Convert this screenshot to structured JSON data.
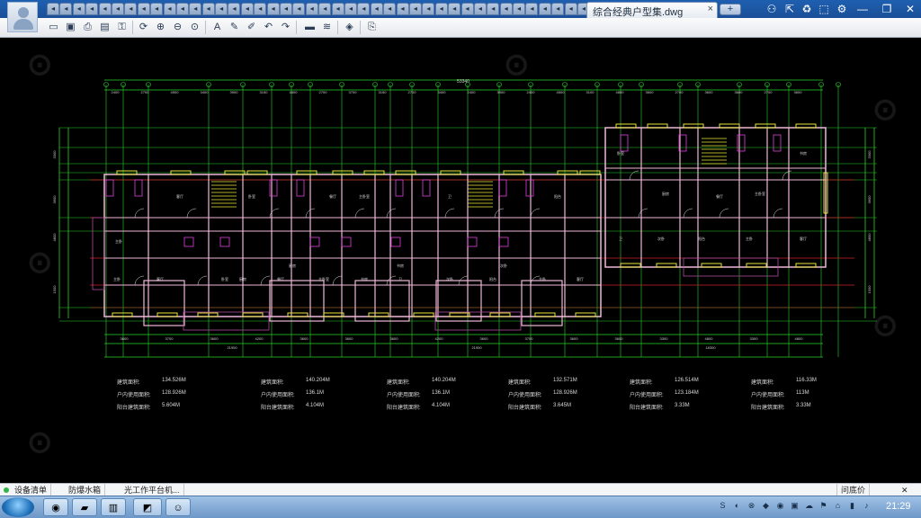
{
  "window": {
    "tab_title": "综合经典户型集.dwg",
    "tab_close": "×",
    "new_tab": "+",
    "controls": [
      "⚇",
      "⇱",
      "♻",
      "⬚",
      "⚙",
      "—",
      "❐",
      "✕"
    ]
  },
  "toolbar": {
    "icons": [
      "open-folder",
      "save",
      "print",
      "pdf",
      "lock",
      "rotate",
      "zoom-in",
      "zoom-out",
      "zoom-window",
      "text",
      "pencil",
      "pen",
      "undo",
      "redo",
      "measure",
      "layers-line",
      "layers",
      "export"
    ]
  },
  "drawing": {
    "top_overall_dim": "53340",
    "top_dims": [
      "2400",
      "2700",
      "4500",
      "3400",
      "3900",
      "3150",
      "4800",
      "2700",
      "3700",
      "3150",
      "2700",
      "3400",
      "2400",
      "3900",
      "2400",
      "4500",
      "3100",
      "4800",
      "3600",
      "2700",
      "3600",
      "3600",
      "2700",
      "3600"
    ],
    "bottom_dims": [
      "3600",
      "3700",
      "3600",
      "4200",
      "3600",
      "3600",
      "3600",
      "4200",
      "3600",
      "3700",
      "3600",
      "3600",
      "3300",
      "4800",
      "3300",
      "4800"
    ],
    "bottom_totals": [
      "21900",
      "21900",
      "18300"
    ],
    "left_dims": [
      "3300",
      "3600",
      "4800",
      "1500"
    ],
    "right_dims": [
      "3300",
      "3600",
      "4800",
      "1500"
    ],
    "rooms": [
      "主卧",
      "客厅",
      "卧室",
      "厨房",
      "餐厅",
      "主卧室",
      "书房",
      "卫",
      "次卧",
      "阳台"
    ]
  },
  "stats": [
    {
      "label": "建筑面积:",
      "value": "134.526M"
    },
    {
      "label": "户内使用面积:",
      "value": "128.926M"
    },
    {
      "label": "阳台建筑面积:",
      "value": "5.604M"
    },
    {
      "label": "建筑面积:",
      "value": "140.204M"
    },
    {
      "label": "户内使用面积:",
      "value": "136.1M"
    },
    {
      "label": "阳台建筑面积:",
      "value": "4.104M"
    },
    {
      "label": "建筑面积:",
      "value": "140.204M"
    },
    {
      "label": "户内使用面积:",
      "value": "136.1M"
    },
    {
      "label": "阳台建筑面积:",
      "value": "4.104M"
    },
    {
      "label": "建筑面积:",
      "value": "132.571M"
    },
    {
      "label": "户内使用面积:",
      "value": "128.926M"
    },
    {
      "label": "阳台建筑面积:",
      "value": "3.645M"
    },
    {
      "label": "建筑面积:",
      "value": "126.514M"
    },
    {
      "label": "户内使用面积:",
      "value": "123.184M"
    },
    {
      "label": "阳台建筑面积:",
      "value": "3.33M"
    },
    {
      "label": "建筑面积:",
      "value": "116.33M"
    },
    {
      "label": "户内使用面积:",
      "value": "113M"
    },
    {
      "label": "阳台建筑面积:",
      "value": "3.33M"
    }
  ],
  "bottom_panel": {
    "tabs": [
      "设备清单",
      "防爆水箱",
      "光工作平台机..."
    ],
    "right_label": "问底价",
    "right_close": "✕"
  },
  "taskbar": {
    "clock": "21:29"
  },
  "colors": {
    "title_bar": "#1f5fb0",
    "axis_green": "#29d42a",
    "axis_red": "#d0242a",
    "wall_pink": "#f0b8d8",
    "window_yellow": "#e6e63a",
    "fixture_magenta": "#e040e0",
    "dim_text": "#cfcfcf"
  }
}
